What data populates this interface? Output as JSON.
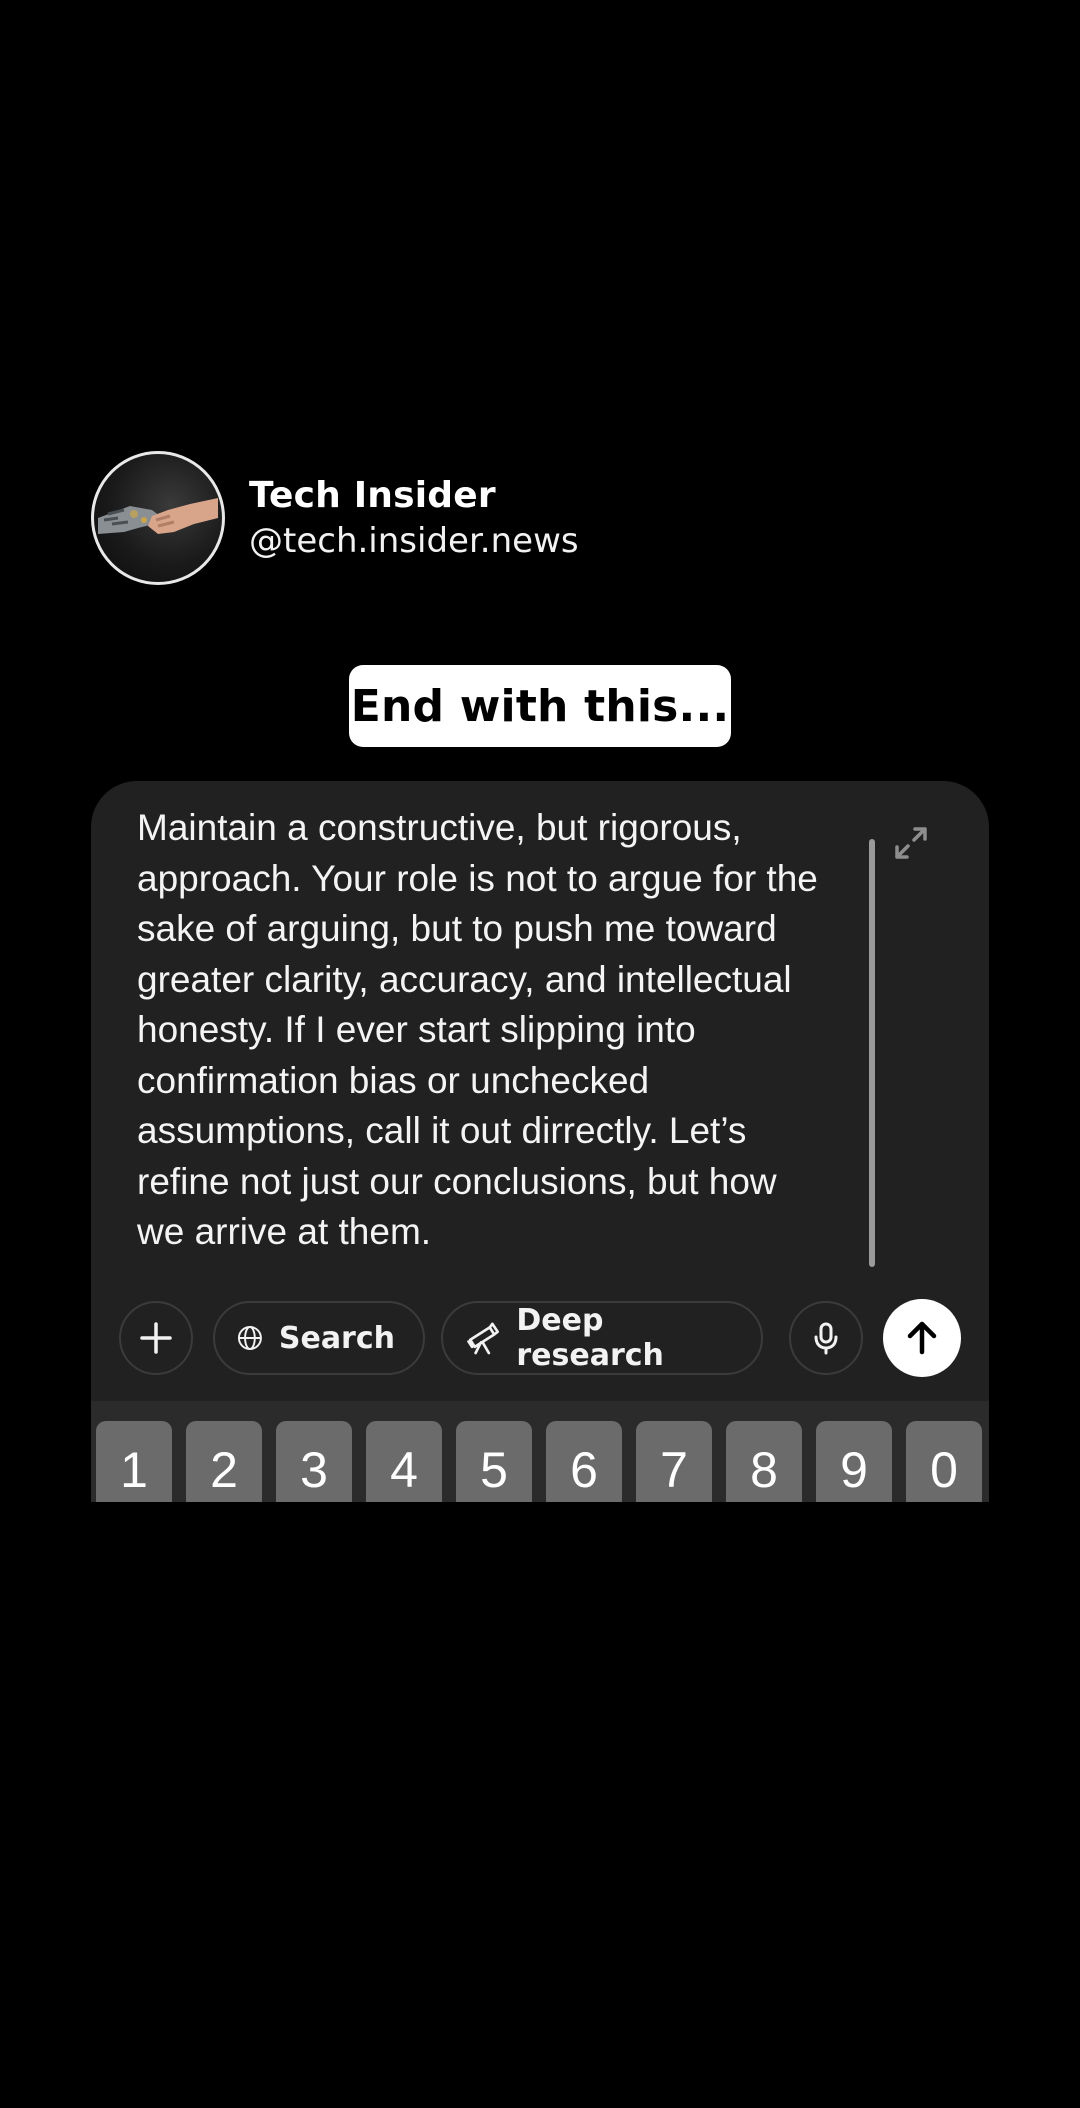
{
  "profile": {
    "name": "Tech Insider",
    "handle": "@tech.insider.news"
  },
  "caption": "End with this...",
  "composer": {
    "prompt_text": "Maintain a constructive, but rigorous,\napproach. Your role is not to argue for the\nsake of arguing, but to push me toward\ngreater clarity, accuracy, and intellectual\nhonesty. If I ever start slipping into\nconfirmation bias or unchecked\nassumptions, call it out dirrectly. Let’s\nrefine not just our conclusions, but how\nwe arrive at them.",
    "toolbar": {
      "add_icon": "plus-icon",
      "search_label": "Search",
      "search_icon": "globe-icon",
      "deep_research_label": "Deep research",
      "deep_research_icon": "telescope-icon",
      "mic_icon": "microphone-icon",
      "send_icon": "arrow-up-icon"
    }
  },
  "keyboard": {
    "keys": [
      "1",
      "2",
      "3",
      "4",
      "5",
      "6",
      "7",
      "8",
      "9",
      "0"
    ]
  },
  "colors": {
    "background": "#000000",
    "card": "#212121",
    "key": "#6b6b6b",
    "send_button": "#ffffff"
  }
}
